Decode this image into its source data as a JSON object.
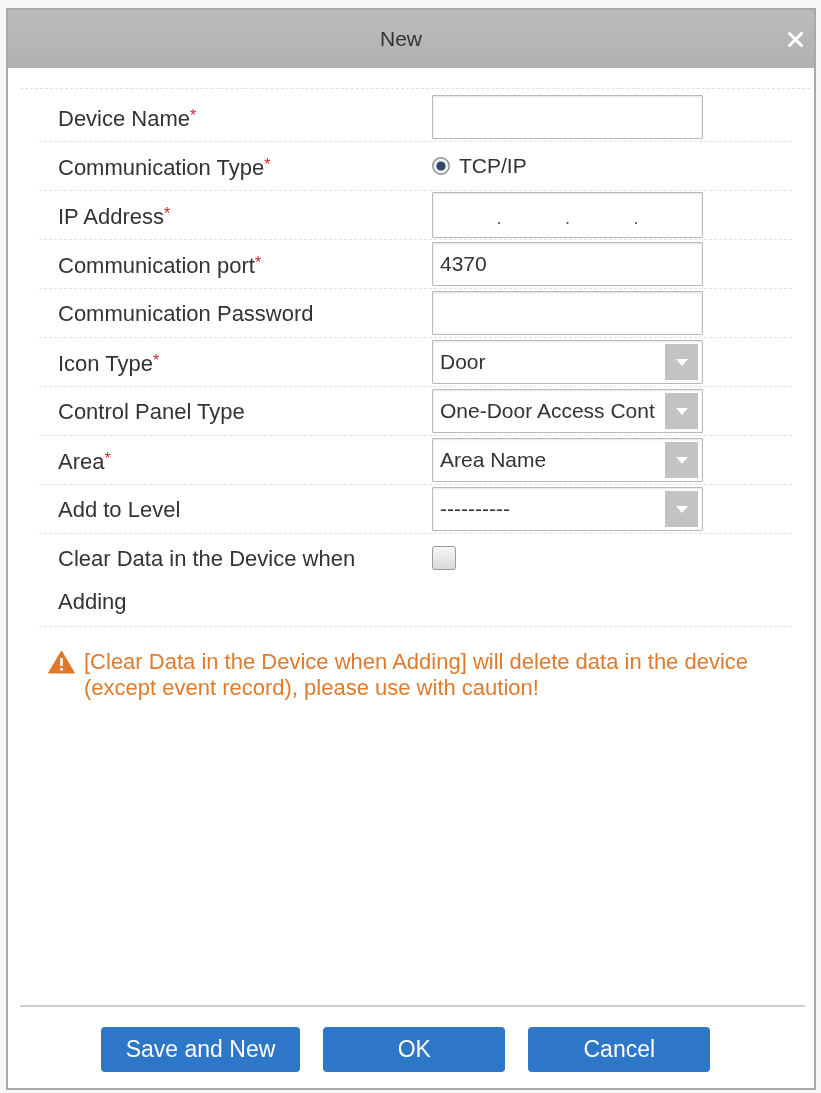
{
  "dialog": {
    "title": "New"
  },
  "form": {
    "rows": [
      {
        "kind": "text",
        "label": "Device Name",
        "required_mark": "*"
      },
      {
        "kind": "radio",
        "label": "Communication Type",
        "required_mark": "*",
        "options": [
          {
            "label": "TCP/IP",
            "selected": true
          }
        ]
      },
      {
        "kind": "ip",
        "label": "IP Address",
        "required_mark": "*",
        "separators": [
          ".",
          ".",
          "."
        ]
      },
      {
        "kind": "text",
        "label": "Communication port",
        "required_mark": "*",
        "value": "4370"
      },
      {
        "kind": "text",
        "label": "Communication Password"
      },
      {
        "kind": "select",
        "label": "Icon Type",
        "required_mark": "*",
        "value": "Door"
      },
      {
        "kind": "select",
        "label": "Control Panel Type",
        "value": "One-Door Access Cont"
      },
      {
        "kind": "select",
        "label": "Area",
        "required_mark": "*",
        "value": "Area Name"
      },
      {
        "kind": "select",
        "label": "Add to Level",
        "value": "----------"
      },
      {
        "kind": "checkbox",
        "label": "Clear Data in the Device when Adding",
        "checked": false
      }
    ]
  },
  "warning": {
    "text": "[Clear Data in the Device when Adding] will delete data in the device (except event record), please use with caution!"
  },
  "buttons": [
    {
      "label": "Save and New"
    },
    {
      "label": "OK"
    },
    {
      "label": "Cancel"
    }
  ]
}
